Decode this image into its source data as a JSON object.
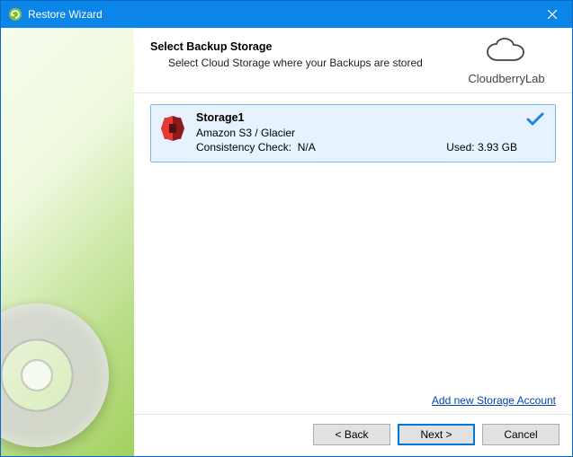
{
  "titlebar": {
    "title": "Restore Wizard"
  },
  "header": {
    "title": "Select Backup Storage",
    "subtitle": "Select Cloud Storage where your Backups are stored"
  },
  "brand": {
    "name": "CloudberryLab"
  },
  "storages": [
    {
      "name": "Storage1",
      "type": "Amazon S3 / Glacier",
      "consistency_label": "Consistency Check:",
      "consistency_value": "N/A",
      "used_label": "Used:",
      "used_value": "3.93 GB"
    }
  ],
  "links": {
    "add_account": "Add new Storage Account"
  },
  "buttons": {
    "back": "< Back",
    "next": "Next >",
    "cancel": "Cancel"
  }
}
